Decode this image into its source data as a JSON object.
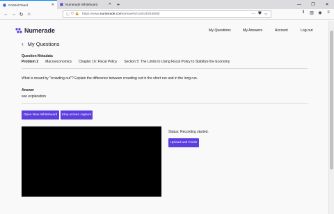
{
  "browser": {
    "tabs": [
      {
        "title": "Control Panel",
        "active": true
      },
      {
        "title": "Numerade Whiteboard",
        "active": false
      }
    ],
    "url_prefix": "https://www.",
    "url_domain": "numerade.com",
    "url_path": "/answers/control/254605/"
  },
  "header": {
    "logo_text": "Numerade",
    "nav": [
      "My Questions",
      "My Answers",
      "Account",
      "Log out"
    ]
  },
  "page": {
    "title": "My Questions",
    "metadata_label": "Question Metadata",
    "metadata": [
      "Problem 2",
      "Macroeconomics",
      "Chapter 16: Fiscal Policy",
      "Section 5: The Limits to Using Fiscal Policy to Stabilize the Economy"
    ],
    "question": "What is meant by \"crowding out\"? Explain the difference between crowding out in the short run and in the long run.",
    "answer_label": "Answer",
    "answer_text": "see explanation",
    "buttons": {
      "whiteboard": "Open New Whiteboard",
      "stop_capture": "Stop screen capture",
      "upload": "Upload and Finish"
    },
    "status": "Status: Recording started."
  },
  "colors": {
    "accent": "#5d3fe0",
    "logo": "#5b3fe0"
  }
}
